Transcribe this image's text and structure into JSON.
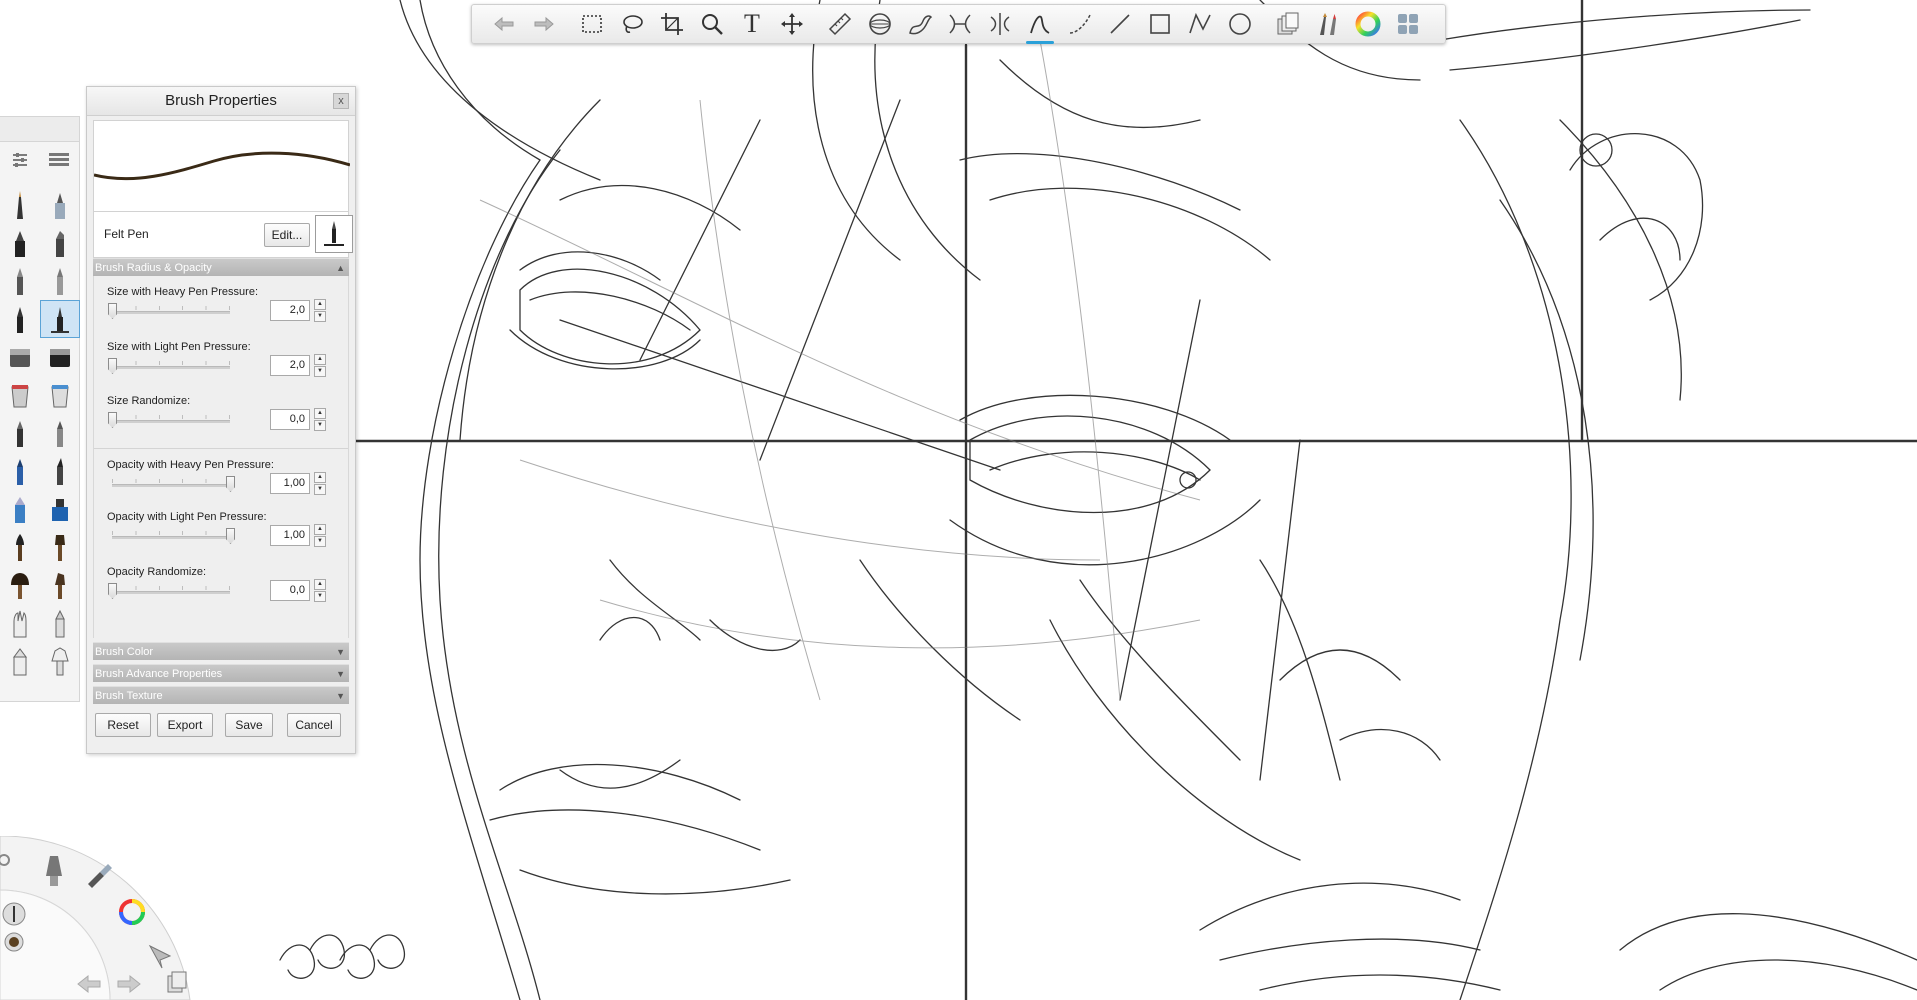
{
  "toolbar": {
    "tools": [
      {
        "icon": "undo-arrow-icon"
      },
      {
        "icon": "redo-arrow-icon"
      },
      {
        "icon": "rectangle-select-icon"
      },
      {
        "icon": "lasso-select-icon"
      },
      {
        "icon": "crop-icon"
      },
      {
        "icon": "zoom-icon"
      },
      {
        "icon": "text-icon",
        "glyph": "T"
      },
      {
        "icon": "move-icon"
      },
      {
        "icon": "ruler-icon"
      },
      {
        "icon": "ellipse-guide-icon"
      },
      {
        "icon": "french-curve-icon"
      },
      {
        "icon": "symmetry-icon"
      },
      {
        "icon": "radial-symmetry-icon"
      },
      {
        "icon": "steady-stroke-icon",
        "active": true
      },
      {
        "icon": "curve-icon"
      },
      {
        "icon": "line-icon"
      },
      {
        "icon": "rectangle-icon"
      },
      {
        "icon": "polyline-icon"
      },
      {
        "icon": "circle-icon"
      },
      {
        "icon": "layers-icon"
      },
      {
        "icon": "brush-palette-icon"
      },
      {
        "icon": "color-wheel-icon"
      },
      {
        "icon": "grid-menu-icon"
      }
    ]
  },
  "brush_properties": {
    "title": "Brush Properties",
    "close_label": "x",
    "brush_name": "Felt Pen",
    "edit_label": "Edit...",
    "section_radius_opacity": "Brush Radius & Opacity",
    "params": [
      {
        "label": "Size with Heavy Pen Pressure:",
        "value": "2,0",
        "level": 0.0
      },
      {
        "label": "Size with Light Pen Pressure:",
        "value": "2,0",
        "level": 0.0
      },
      {
        "label": "Size Randomize:",
        "value": "0,0",
        "level": 0.0
      },
      {
        "label": "Opacity with Heavy Pen Pressure:",
        "value": "1,00",
        "level": 1.0
      },
      {
        "label": "Opacity with Light Pen Pressure:",
        "value": "1,00",
        "level": 1.0
      },
      {
        "label": "Opacity Randomize:",
        "value": "0,0",
        "level": 0.0
      }
    ],
    "section_color": "Brush Color",
    "section_advance": "Brush Advance Properties",
    "section_texture": "Brush Texture",
    "buttons": {
      "reset": "Reset",
      "export": "Export",
      "save": "Save",
      "cancel": "Cancel"
    }
  },
  "colors": {
    "stroke": "#111111",
    "stroke_preview": "#3a2a16",
    "accent": "#2aa0d8"
  }
}
